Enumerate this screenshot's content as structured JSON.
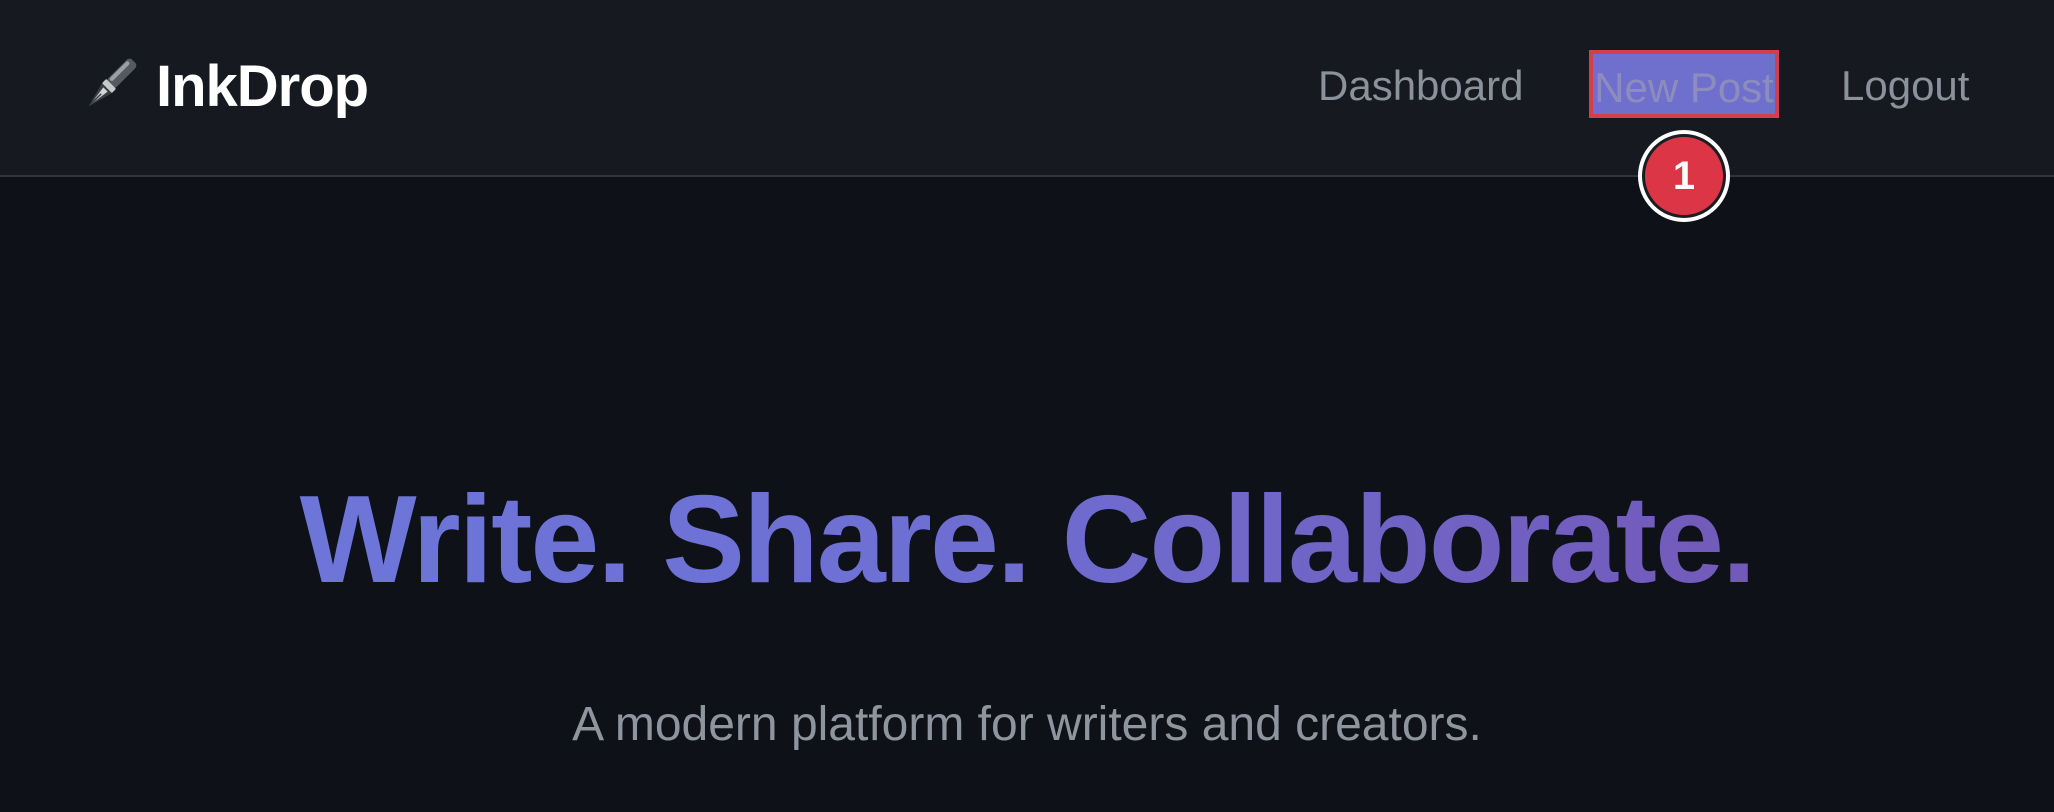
{
  "nav": {
    "brand": {
      "name": "InkDrop",
      "icon": "fountain-pen-icon"
    },
    "links": {
      "dashboard": "Dashboard",
      "new_post": "New Post",
      "logout": "Logout"
    }
  },
  "annotation": {
    "marker_label": "1",
    "highlight_color": "#d3404d"
  },
  "hero": {
    "title": "Write. Share. Collaborate.",
    "subtitle": "A modern platform for writers and creators."
  },
  "colors": {
    "background": "#0e1117",
    "navbar": "#16191f",
    "accent_start": "#6c79db",
    "accent_end": "#7452b0",
    "marker": "#dc3545"
  }
}
